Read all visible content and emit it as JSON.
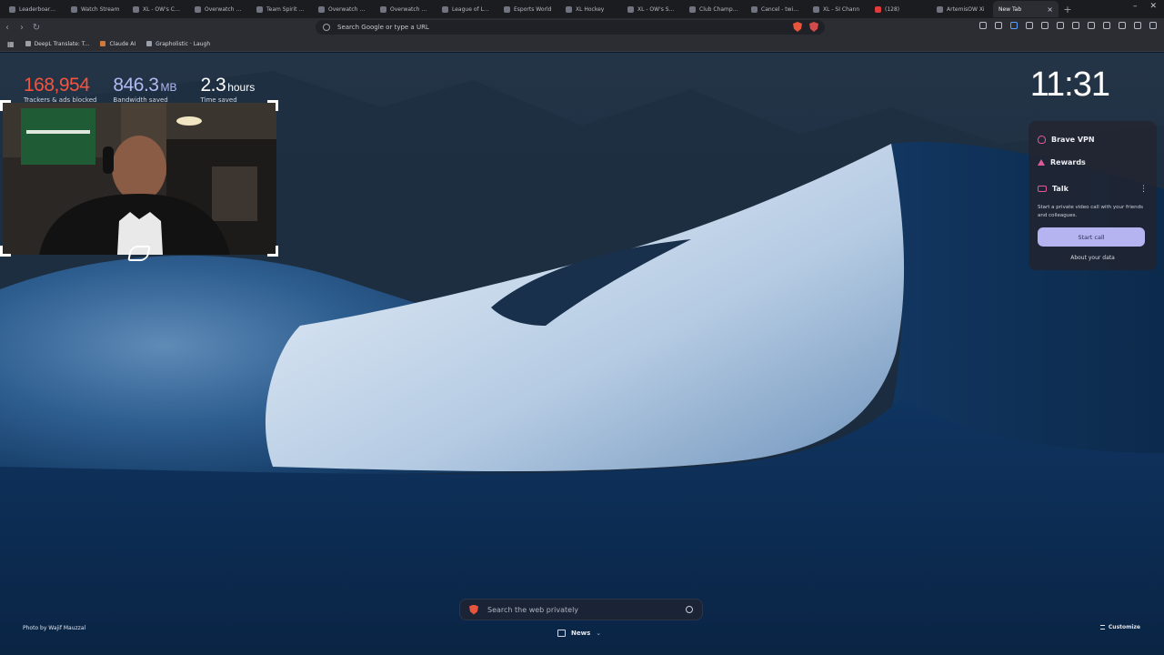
{
  "tabs": [
    {
      "label": "Leaderboard | ..."
    },
    {
      "label": "Watch Stream"
    },
    {
      "label": "XL - OW's Chan"
    },
    {
      "label": "Overwatch Cha"
    },
    {
      "label": "Team Spirit Gra"
    },
    {
      "label": "Overwatch Cha"
    },
    {
      "label": "Overwatch Cha"
    },
    {
      "label": "League of Lege"
    },
    {
      "label": "Esports World"
    },
    {
      "label": "XL Hockey"
    },
    {
      "label": "XL - OW's Sche"
    },
    {
      "label": "Club Champions"
    },
    {
      "label": "Cancel - twitch"
    },
    {
      "label": "XL - SI Chann"
    },
    {
      "label": "(128)"
    },
    {
      "label": "ArtemisOW Xi"
    },
    {
      "label": "New Tab",
      "active": true
    }
  ],
  "toolbar": {
    "omnibox_placeholder": "Search Google or type a URL"
  },
  "bookmarks": [
    {
      "label": "DeepL Translate: T..."
    },
    {
      "label": "Claude AI"
    },
    {
      "label": "Grapholistic · Laugh"
    }
  ],
  "stats": {
    "trackers": "168,954",
    "trackers_caption": "Trackers & ads blocked",
    "bandwidth": "846.3",
    "bandwidth_unit": "MB",
    "bandwidth_caption": "Bandwidth saved",
    "time": "2.3",
    "time_unit": "hours",
    "time_caption": "Time saved"
  },
  "clock": "11:31",
  "panel": {
    "vpn_label": "Brave VPN",
    "rewards_label": "Rewards",
    "talk_label": "Talk",
    "talk_desc": "Start a private video call with your friends and colleagues.",
    "start_call_label": "Start call",
    "about_data_label": "About your data"
  },
  "search": {
    "placeholder": "Search the web privately"
  },
  "news_label": "News",
  "photo_credit": "Photo by Wajif Mauzzal",
  "customize_label": "Customize",
  "colors": {
    "trackers": "#f2553f",
    "bandwidth": "#b4b8f3",
    "start_call": "#b5b3f0",
    "brave_orange": "#e8553d"
  }
}
